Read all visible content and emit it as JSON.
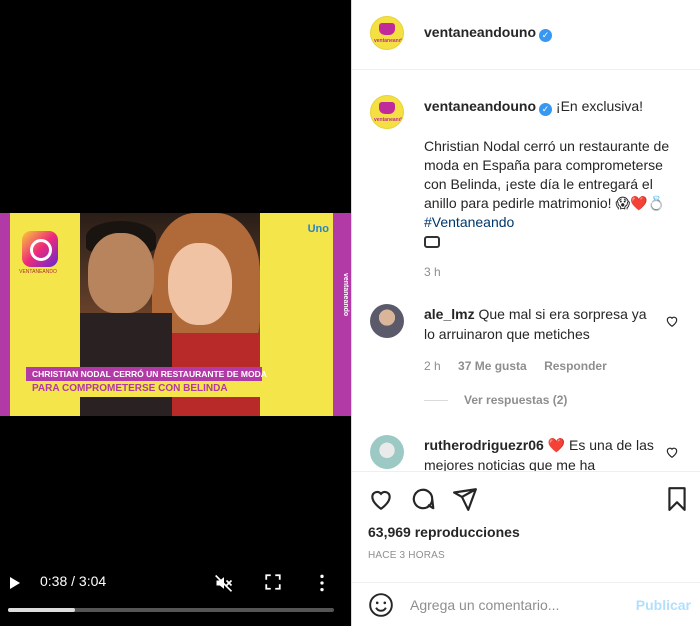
{
  "video": {
    "ig_handle": "VENTANEANDO",
    "channel_tag": "Uno",
    "side_text": "ventaneando",
    "lower_third_line1": "CHRISTIAN NODAL CERRÓ UN RESTAURANTE DE MODA",
    "lower_third_line2": "PARA COMPROMETERSE CON BELINDA",
    "time": "0:38 / 3:04",
    "progress_fraction": 0.207,
    "icons": {
      "play": "play-icon",
      "mute": "muted-speaker-icon",
      "fullscreen": "fullscreen-icon",
      "more": "more-options-icon"
    }
  },
  "header": {
    "username": "ventaneandouno",
    "verified_mark": "✓",
    "avatar_text": "ventaneando"
  },
  "caption": {
    "username": "ventaneandouno",
    "lead": "¡En exclusiva!",
    "body": "Christian Nodal cerró un restaurante de moda en España para comprometerse con Belinda, ¡este día le entregará el anillo para pedirle matrimonio!",
    "emojis": "😱❤️💍",
    "hashtag": "#Ventaneando",
    "timestamp": "3 h"
  },
  "comments": [
    {
      "username": "ale_lmz",
      "text": "Que mal si era sorpresa ya lo arruinaron que metiches",
      "time": "2 h",
      "likes": "37 Me gusta",
      "reply": "Responder",
      "view_replies": "Ver respuestas (2)"
    },
    {
      "username": "rutherodriguezr06",
      "emoji": "❤️",
      "text": "Es una de las mejores noticias que me ha"
    }
  ],
  "actions": {
    "views": "63,969 reproducciones",
    "posted": "HACE 3 HORAS",
    "icons": [
      "heart-icon",
      "comment-icon",
      "share-icon",
      "bookmark-icon"
    ]
  },
  "composer": {
    "placeholder": "Agrega un comentario...",
    "publish": "Publicar"
  }
}
